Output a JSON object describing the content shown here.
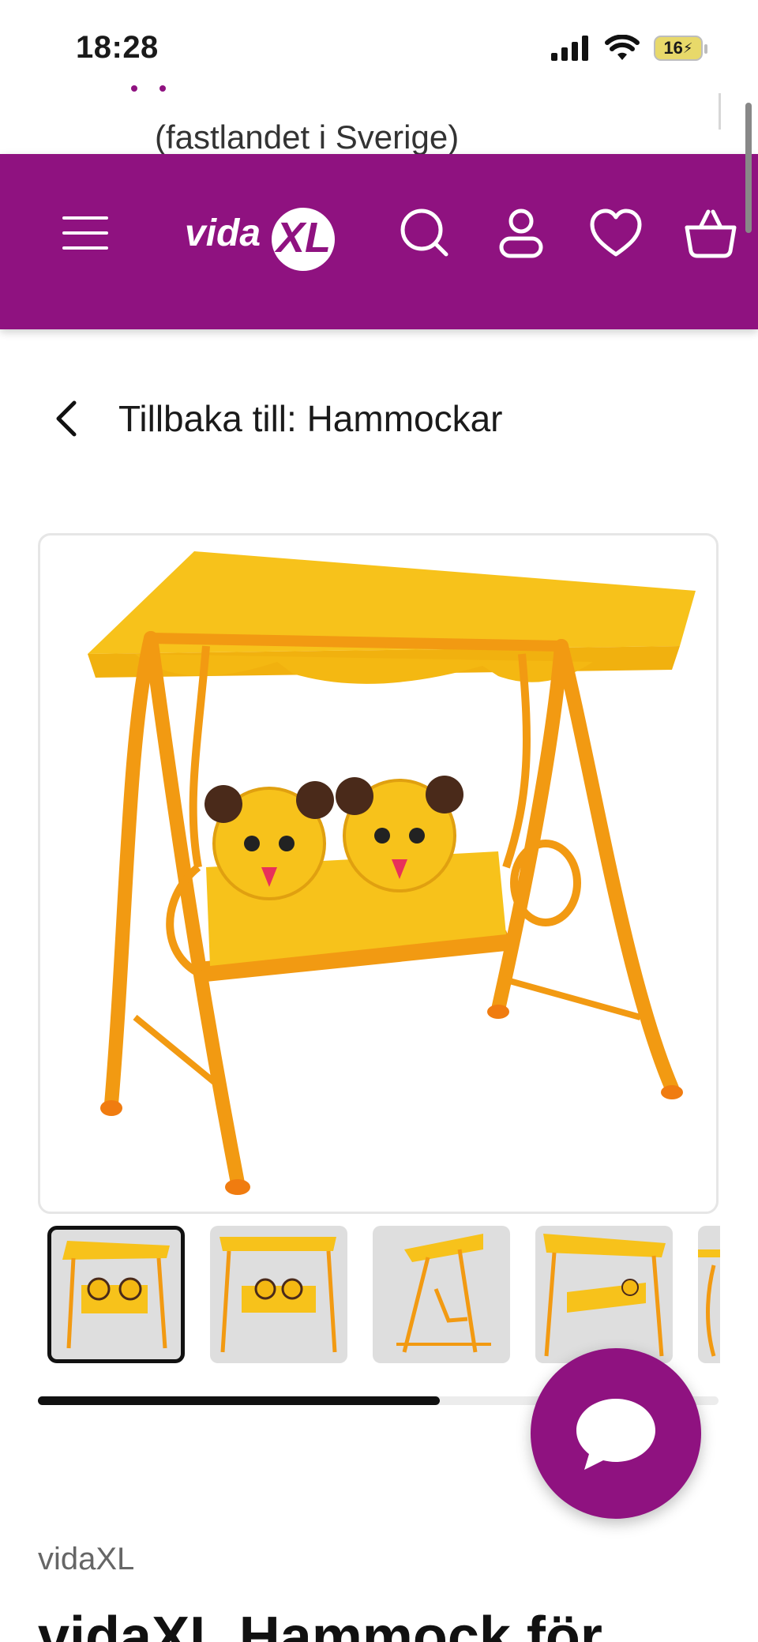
{
  "status_bar": {
    "time": "18:28",
    "battery": "16"
  },
  "announcement": {
    "text": "(fastlandet i Sverige)"
  },
  "header": {
    "logo_text": "vidaXL",
    "brand_color": "#8f1280",
    "icons": [
      "menu-icon",
      "search-icon",
      "account-icon",
      "heart-icon",
      "basket-icon"
    ]
  },
  "navigation": {
    "back_label": "Tillbaka till: Hammockar"
  },
  "gallery": {
    "main_image_alt": "Hammock för barn gul",
    "thumbnail_count_visible": 5,
    "active_thumbnail": 1,
    "scroll_progress": 0.59
  },
  "product": {
    "brand": "vidaXL",
    "title": "vidaXL Hammock för"
  },
  "chat": {
    "icon": "chat-bubble-icon"
  }
}
